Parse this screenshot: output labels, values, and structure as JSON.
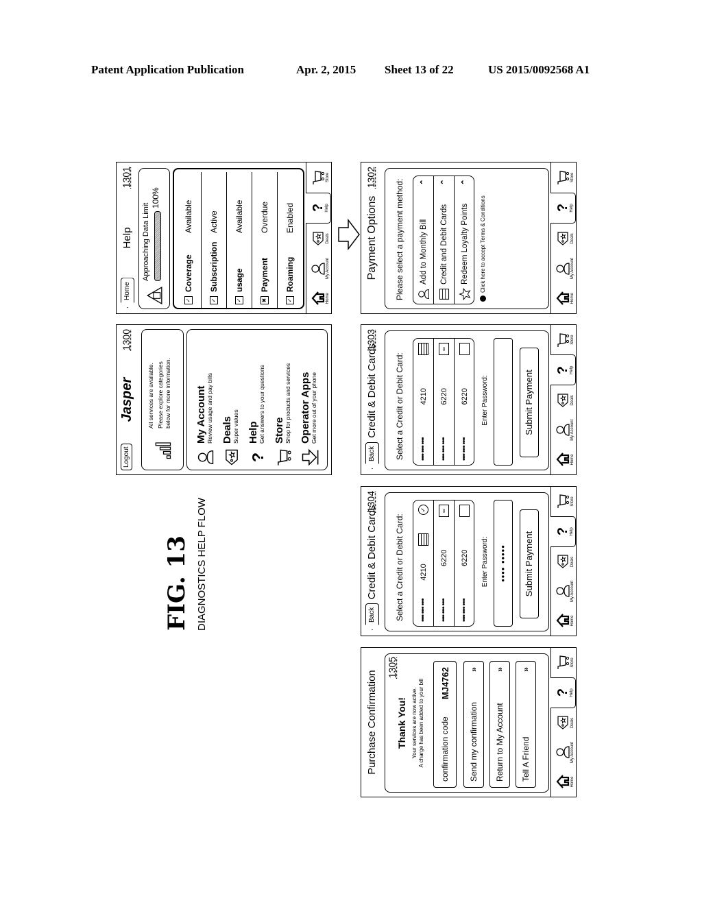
{
  "header": {
    "publication": "Patent Application Publication",
    "date": "Apr. 2, 2015",
    "sheet": "Sheet 13 of 22",
    "number": "US 2015/0092568 A1"
  },
  "figure": {
    "label": "FIG. 13",
    "caption": "DIAGNOSTICS HELP FLOW"
  },
  "tabbar": {
    "items": [
      {
        "label": "Home",
        "icon": "home-icon"
      },
      {
        "label": "My Account",
        "icon": "user-icon"
      },
      {
        "label": "Deals",
        "icon": "tag-icon"
      },
      {
        "label": "Help",
        "icon": "question-icon"
      },
      {
        "label": "Store",
        "icon": "cart-icon"
      }
    ]
  },
  "screens": {
    "s1300": {
      "ref": "1300",
      "logout": "Logout",
      "brand": "Jasper",
      "status_line1": "All services are available.",
      "status_line2": "Please explore categories",
      "status_line3": "below for more information.",
      "menu": [
        {
          "title": "My Account",
          "subtitle": "Review usage and pay bills",
          "icon": "user-icon"
        },
        {
          "title": "Deals",
          "subtitle": "Super values",
          "icon": "tag-icon"
        },
        {
          "title": "Help",
          "subtitle": "Get answers to your questions",
          "icon": "question-icon"
        },
        {
          "title": "Store",
          "subtitle": "Shop for products and services",
          "icon": "cart-icon"
        },
        {
          "title": "Operator Apps",
          "subtitle": "Get more out of your phone",
          "icon": "download-icon"
        }
      ]
    },
    "s1301": {
      "ref": "1301",
      "home": "Home",
      "title": "Help",
      "alert": "Approaching Data Limit",
      "usage_percent": "100%",
      "usage_fraction": 1.0,
      "items": [
        {
          "label": "Coverage",
          "status": "Available",
          "check": "ok"
        },
        {
          "label": "Subscription",
          "status": "Active",
          "check": "ok"
        },
        {
          "label": "usage",
          "status": "Available",
          "check": "ok"
        },
        {
          "label": "Payment",
          "status": "Overdue",
          "check": "error"
        },
        {
          "label": "Roaming",
          "status": "Enabled",
          "check": "ok"
        }
      ]
    },
    "s1302": {
      "ref": "1302",
      "title": "Payment Options",
      "prompt": "Please select a payment method:",
      "options": [
        {
          "label": "Add to Monthly Bill",
          "icon": "user-icon"
        },
        {
          "label": "Credit and Debit Cards",
          "icon": "card-icon"
        },
        {
          "label": "Redeem Loyalty Points",
          "icon": "star-icon"
        }
      ],
      "terms": "Click here to accept Terms & Conditions"
    },
    "s1303": {
      "ref": "1303",
      "back": "Back",
      "title": "Credit & Debit Cards",
      "prompt": "Select a Credit or Debit Card:",
      "cards": [
        {
          "masked": "•••• •••• ••••",
          "last4": "4210",
          "brand": "striped-card-icon"
        },
        {
          "masked": "•••• •••• ••••",
          "last4": "6220",
          "brand": "mastercard-icon"
        },
        {
          "masked": "•••• •••• ••••",
          "last4": "6220",
          "brand": "blank-card-icon"
        }
      ],
      "password_label": "Enter Password:",
      "password_value": "",
      "submit": "Submit Payment"
    },
    "s1304": {
      "ref": "1304",
      "back": "Back",
      "title": "Credit & Debit Cards",
      "prompt": "Select a Credit or Debit Card:",
      "cards": [
        {
          "masked": "•••• •••• ••••",
          "last4": "4210",
          "brand": "striped-card-icon",
          "selected": true
        },
        {
          "masked": "•••• •••• ••••",
          "last4": "6220",
          "brand": "mastercard-icon"
        },
        {
          "masked": "•••• •••• ••••",
          "last4": "6220",
          "brand": "blank-card-icon"
        }
      ],
      "password_label": "Enter Password:",
      "password_value": "•••• •••••",
      "submit": "Submit Payment"
    },
    "s1305": {
      "ref": "1305",
      "title": "Purchase Confirmation",
      "thanks": "Thank You!",
      "msg1": "Your services are now active.",
      "msg2": "A charge has been added to your bill",
      "code_label": "confirmation code",
      "code_value": "MJ4762",
      "actions": [
        "Send my confirmation",
        "Return to My Account",
        "Tell A Friend"
      ]
    }
  }
}
